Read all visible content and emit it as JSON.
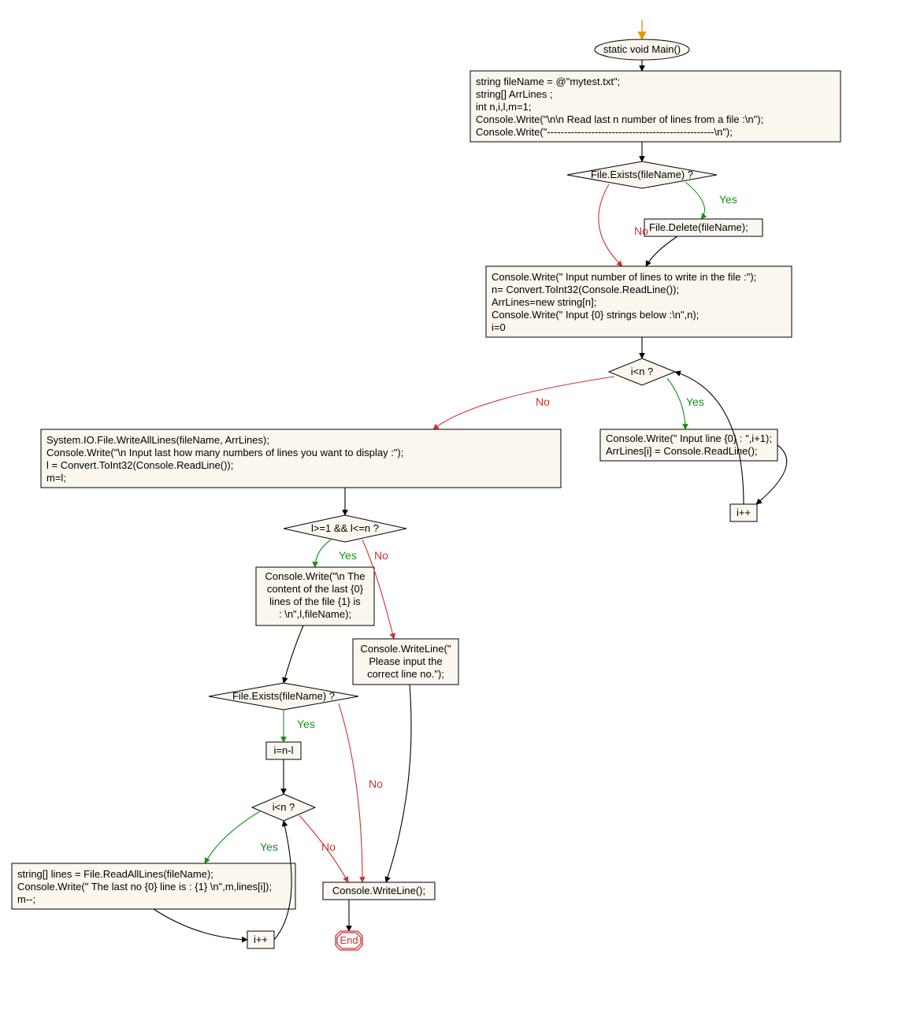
{
  "colors": {
    "nodeFill": "#fbf7ef",
    "yes": "#1a8f1a",
    "no": "#c33",
    "edge": "#000",
    "entryArrow": "#e39a00"
  },
  "labels": {
    "yes": "Yes",
    "no": "No",
    "end": "End"
  },
  "nodes": {
    "main": "static void Main()",
    "init1": "string fileName = @\"mytest.txt\";",
    "init2": "string[] ArrLines ;",
    "init3": "int n,i,l,m=1;",
    "init4": "Console.Write(\"\\n\\n Read last n number of lines from a file  :\\n\");",
    "init5": "Console.Write(\"-------------------------------------------------\\n\");",
    "d1": "File.Exists(fileName) ?",
    "delete": "File.Delete(fileName);",
    "prompt1": "Console.Write(\" Input number of lines to write in the file  :\");",
    "prompt2": "n= Convert.ToInt32(Console.ReadLine());",
    "prompt3": "ArrLines=new string[n];",
    "prompt4": "Console.Write(\" Input {0} strings below :\\n\",n);",
    "prompt5": "i=0",
    "d2": "i<n ?",
    "loop1a": "Console.Write(\" Input line {0} : \",i+1);",
    "loop1b": "ArrLines[i] = Console.ReadLine();",
    "incr1": "i++",
    "after1a": "System.IO.File.WriteAllLines(fileName, ArrLines);",
    "after1b": "Console.Write(\"\\n Input last how many numbers of lines you want to display  :\");",
    "after1c": "l = Convert.ToInt32(Console.ReadLine());",
    "after1d": "m=l;",
    "d3": "l>=1 && l<=n ?",
    "content": "Console.Write(\"\\n The content of the last {0} lines of the file {1} is  : \\n\",l,fileName);",
    "badline": "Console.WriteLine(\" Please input the correct line no.\");",
    "d4": "File.Exists(fileName) ?",
    "setnl": "i=n-l",
    "d5": "i<n ?",
    "loop2a": "string[] lines = File.ReadAllLines(fileName);",
    "loop2b": "Console.Write(\" The last no {0} line is : {1} \\n\",m,lines[i]);",
    "loop2c": "m--;",
    "incr2": "i++",
    "wl": "Console.WriteLine();"
  }
}
